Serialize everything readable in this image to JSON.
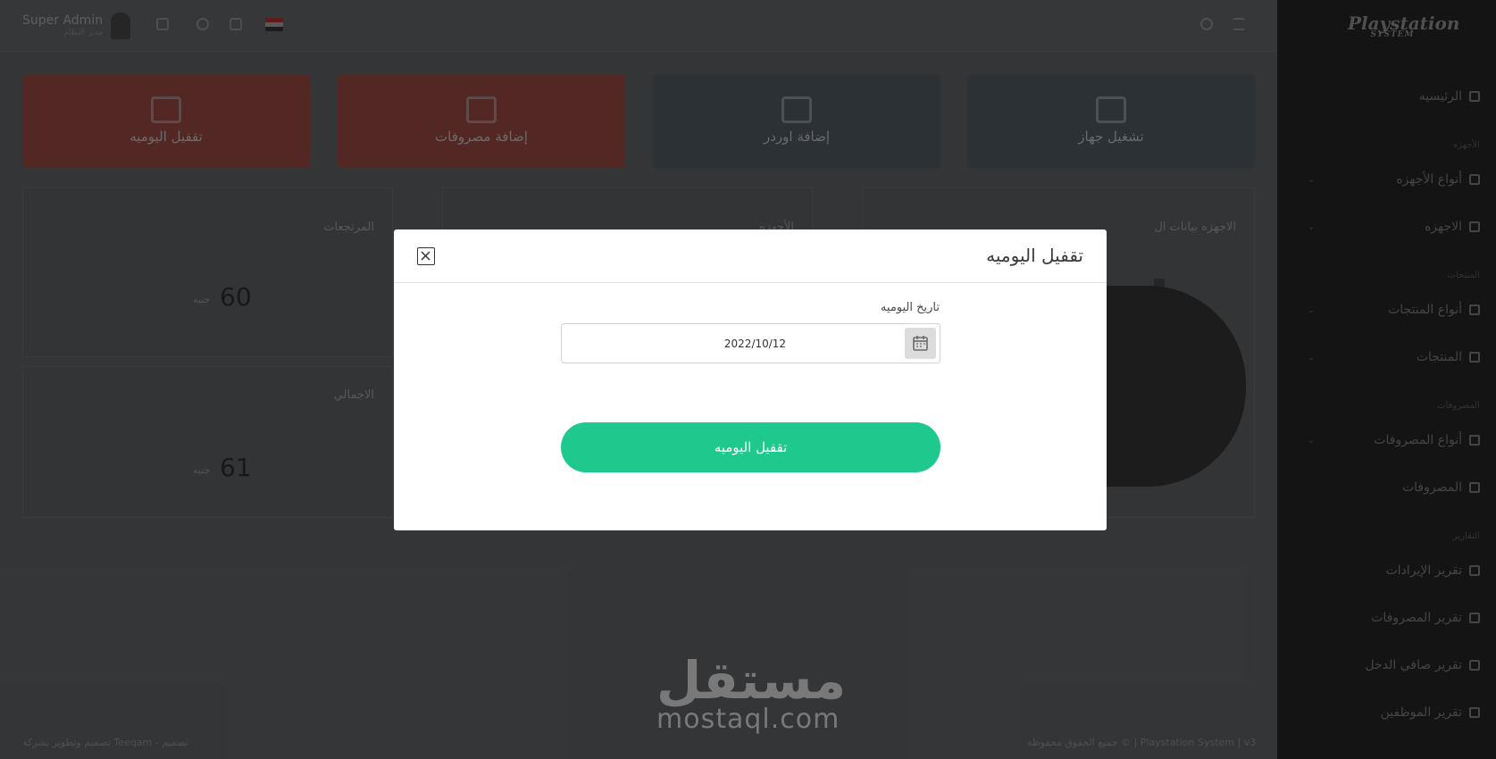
{
  "topbar": {
    "user_name": "Super Admin",
    "user_role": "مدير النظام"
  },
  "sidebar": {
    "logo_main": "Playstation",
    "logo_sub": "SYSTEM",
    "items": [
      {
        "label": "الرئيسيه"
      },
      {
        "label": "الأجهزه",
        "section": true
      },
      {
        "label": "أنواع الأجهزه"
      },
      {
        "label": "الاجهزه"
      },
      {
        "label": "المنتجات",
        "section": true
      },
      {
        "label": "أنواع المنتجات"
      },
      {
        "label": "المنتجات"
      },
      {
        "label": "المصروفات",
        "section": true
      },
      {
        "label": "أنواع المصروفات"
      },
      {
        "label": "المصروفات"
      },
      {
        "label": "التقارير",
        "section": true
      },
      {
        "label": "تقرير الإيرادات"
      },
      {
        "label": "تقرير المصروفات"
      },
      {
        "label": "تقرير صافي الدخل"
      },
      {
        "label": "تقرير الموظفين"
      }
    ]
  },
  "cards": [
    {
      "label": "تشغيل جهاز"
    },
    {
      "label": "إضافة اوردر"
    },
    {
      "label": "إضافة مصروفات"
    },
    {
      "label": "تقفيل اليوميه"
    }
  ],
  "panels": {
    "p1_title": "المرتجعات",
    "p1_value": "60",
    "p1_unit": "جنيه",
    "p2_title": "الاجمالي",
    "p2_value": "61",
    "p2_unit": "جنيه",
    "p3_title": "الأجهزه",
    "p4_title": "الاجهزه بيانات ال"
  },
  "footer": {
    "left": "تصميم وتطوير بشركة Teeqam - تصميم",
    "right": "جميع الحقوق محفوظة © | Playstation System | v3"
  },
  "watermark": {
    "arabic": "مستقل",
    "latin": "mostaql.com"
  },
  "modal": {
    "title": "تقفيل اليوميه",
    "field_label": "تاريخ اليوميه",
    "date_value": "2022/10/12",
    "submit_label": "تقفيل اليوميه"
  }
}
